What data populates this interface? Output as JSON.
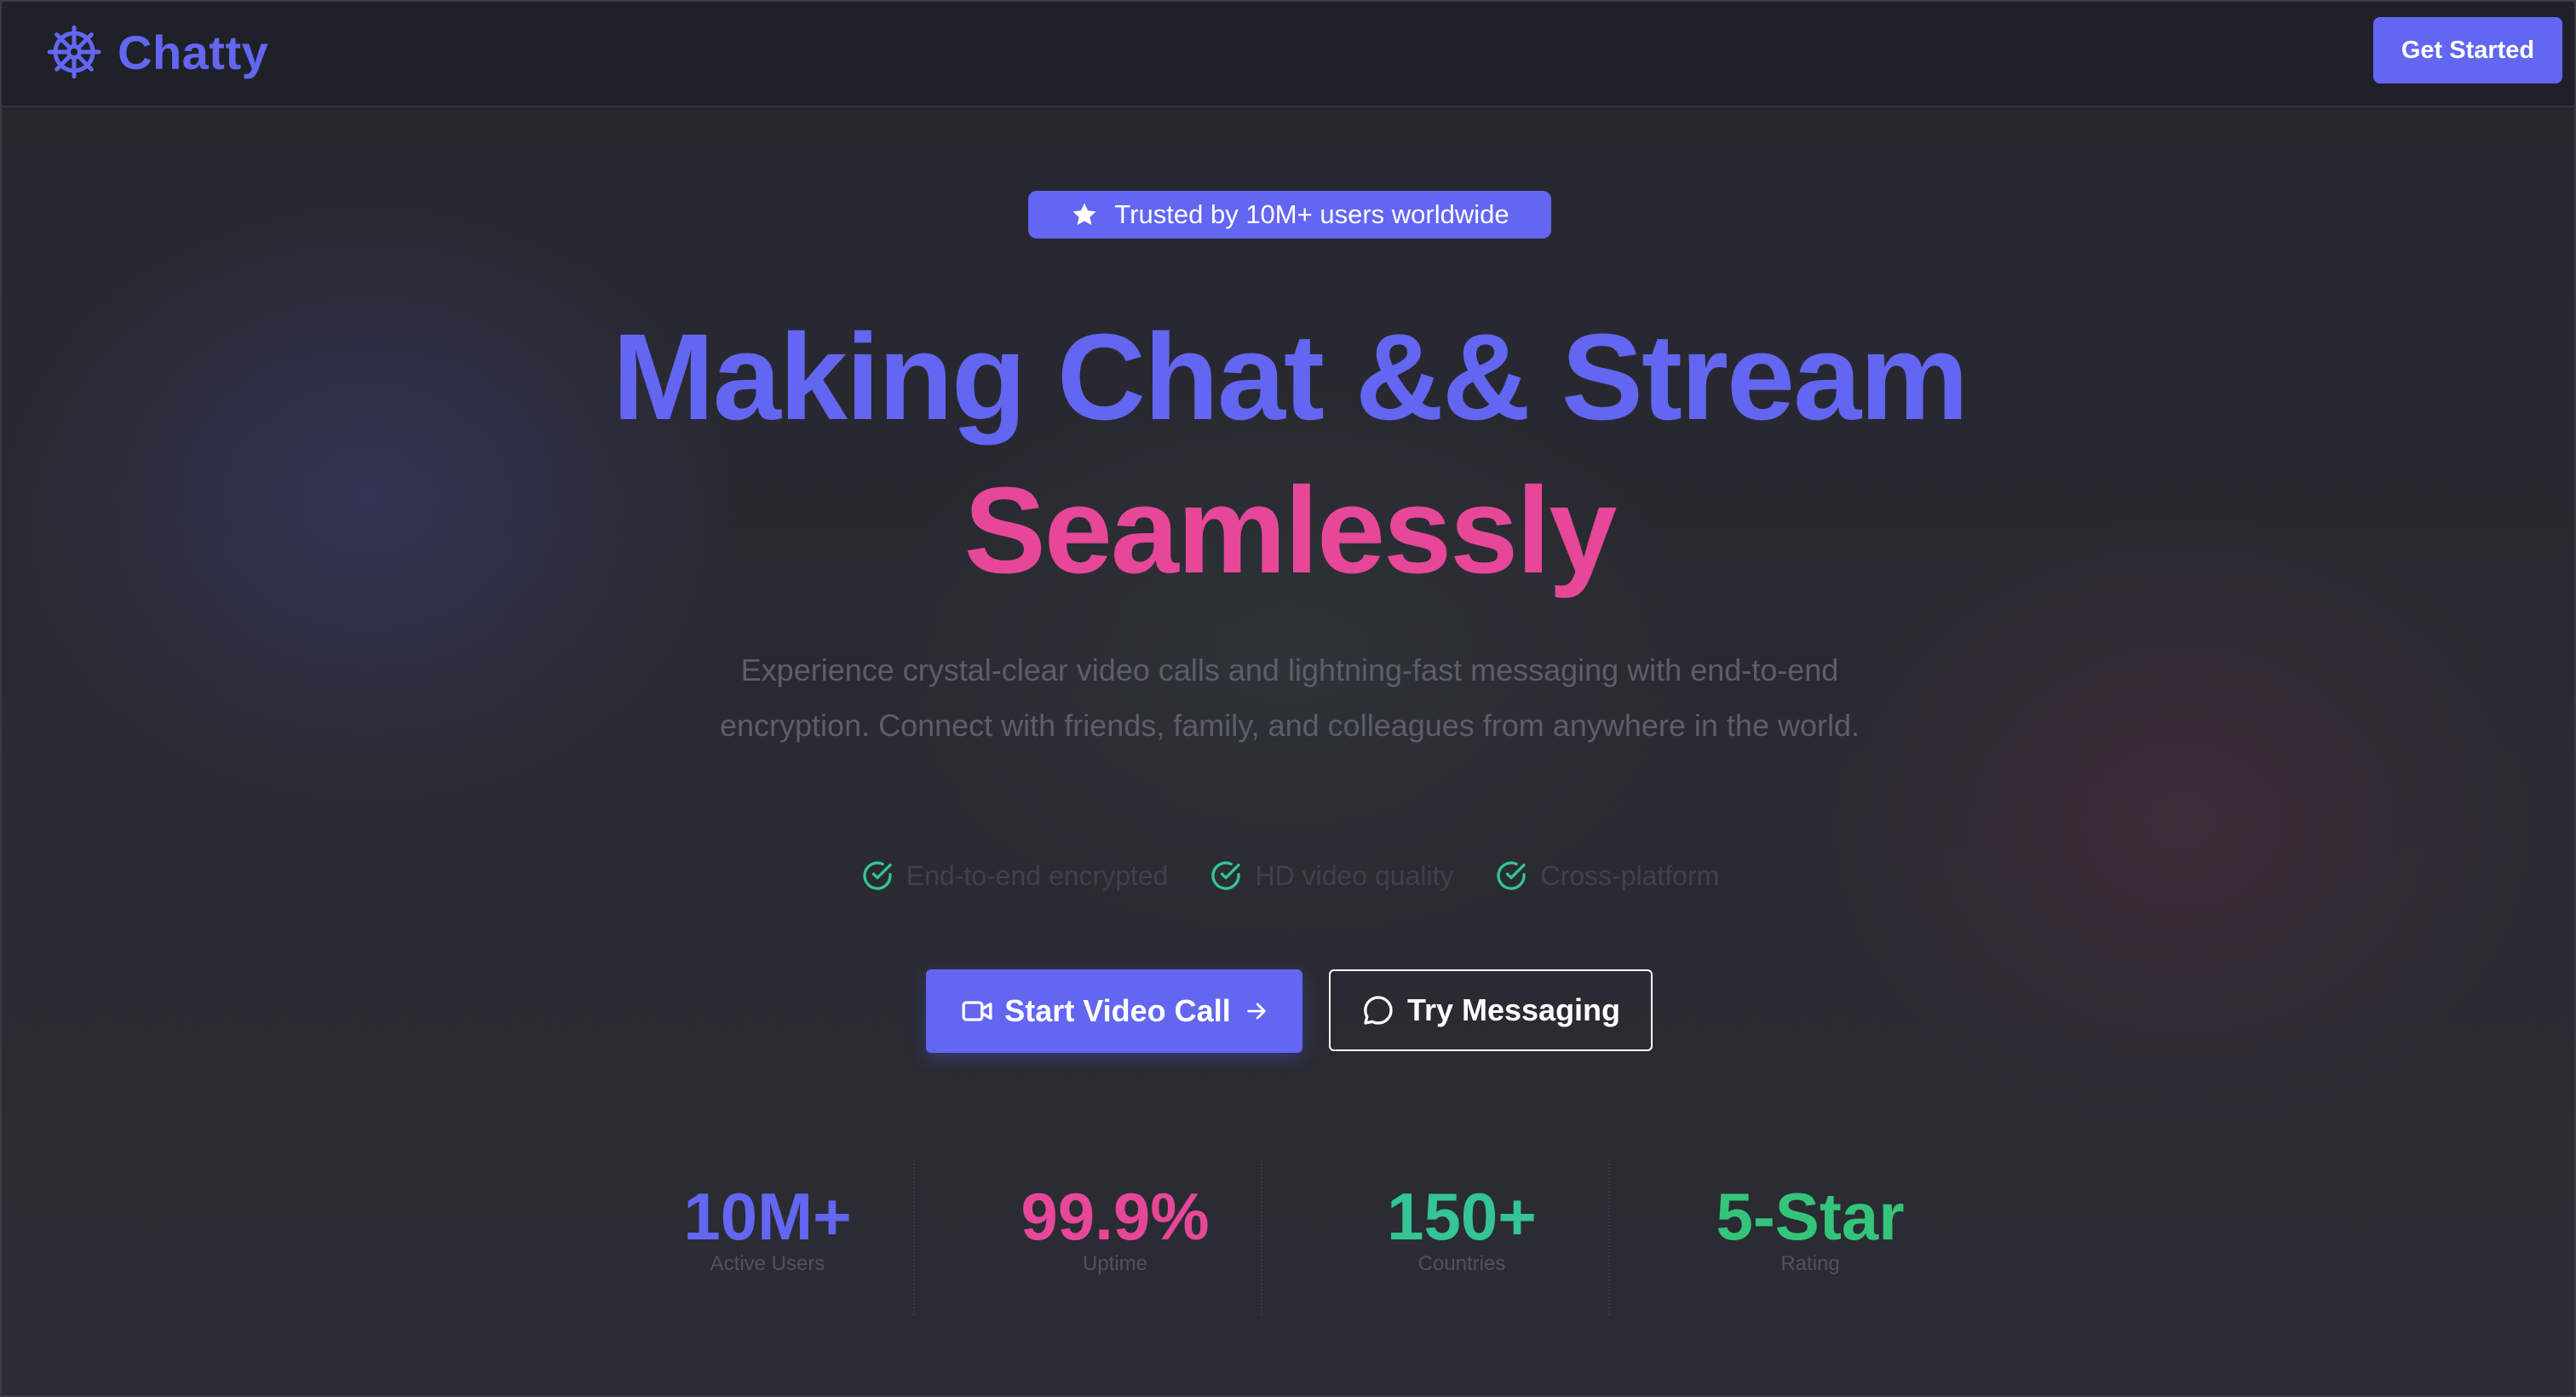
{
  "header": {
    "brand_name": "Chatty",
    "brand_icon": "ship-wheel-icon",
    "cta_label": "Get Started"
  },
  "badge": {
    "icon": "star-icon",
    "label": "Trusted by 10M+ users worldwide"
  },
  "hero": {
    "headline_line1": "Making Chat && Stream",
    "headline_line2": "Seamlessly",
    "subtitle": "Experience crystal-clear video calls and lightning-fast messaging with end-to-end encryption. Connect with friends, family, and colleagues from anywhere in the world."
  },
  "features": [
    {
      "icon": "check-circle-icon",
      "label": "End-to-end encrypted"
    },
    {
      "icon": "check-circle-icon",
      "label": "HD video quality"
    },
    {
      "icon": "check-circle-icon",
      "label": "Cross-platform"
    }
  ],
  "actions": {
    "primary": {
      "label": "Start Video Call",
      "icon": "video-camera-icon",
      "trailing_icon": "arrow-right-icon"
    },
    "secondary": {
      "label": "Try Messaging",
      "icon": "chat-bubble-icon"
    }
  },
  "stats": [
    {
      "value": "10M+",
      "label": "Active Users",
      "color": "#6366f1"
    },
    {
      "value": "99.9%",
      "label": "Uptime",
      "color": "#e74799"
    },
    {
      "value": "150+",
      "label": "Countries",
      "color": "#34c495"
    },
    {
      "value": "5-Star",
      "label": "Rating",
      "color": "#34c47a"
    }
  ],
  "colors": {
    "accent": "#6366f1",
    "highlight": "#e74799",
    "success": "#34c495",
    "background": "#272830"
  }
}
